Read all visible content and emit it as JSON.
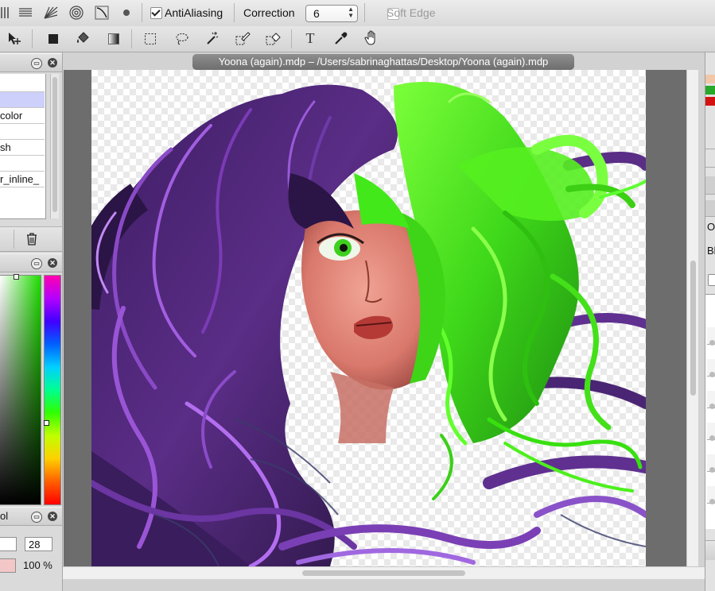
{
  "toolbar_top": {
    "icons": [
      "hatch-icon",
      "horizontal-lines-icon",
      "radial-lines-icon",
      "concentric-circles-icon",
      "curve-icon",
      "dot-icon"
    ],
    "antialiasing_label": "AntiAliasing",
    "antialiasing_checked": true,
    "correction_label": "Correction",
    "correction_value": "6",
    "soft_edge_label": "Soft Edge",
    "soft_edge_checked": false
  },
  "toolbar_tools": [
    "move-icon",
    "rectangle-fill-icon",
    "bucket-fill-icon",
    "gradient-icon",
    "rect-select-icon",
    "lasso-icon",
    "magic-wand-icon",
    "select-pen-icon",
    "select-eraser-icon",
    "text-icon",
    "eyedropper-icon",
    "hand-icon"
  ],
  "text_tool_glyph": "T",
  "brush_panel": {
    "items": [
      "",
      "",
      "color",
      "",
      "sh",
      "",
      "r_inline_"
    ]
  },
  "color_panel": {},
  "brush_size_panel": {
    "title": "ol",
    "size_value": "28",
    "opacity_label": "100 %"
  },
  "document": {
    "title": "Yoona (again).mdp – /Users/sabrinaghattas/Desktop/Yoona (again).mdp"
  },
  "right_panel": {
    "label_o": "O",
    "label_bl": "Bl"
  },
  "colors": {
    "hair_purple": "#5a2d86",
    "hair_green": "#4cf01c",
    "skin": "#e08a7c",
    "selected_row": "#ccd0fa"
  }
}
